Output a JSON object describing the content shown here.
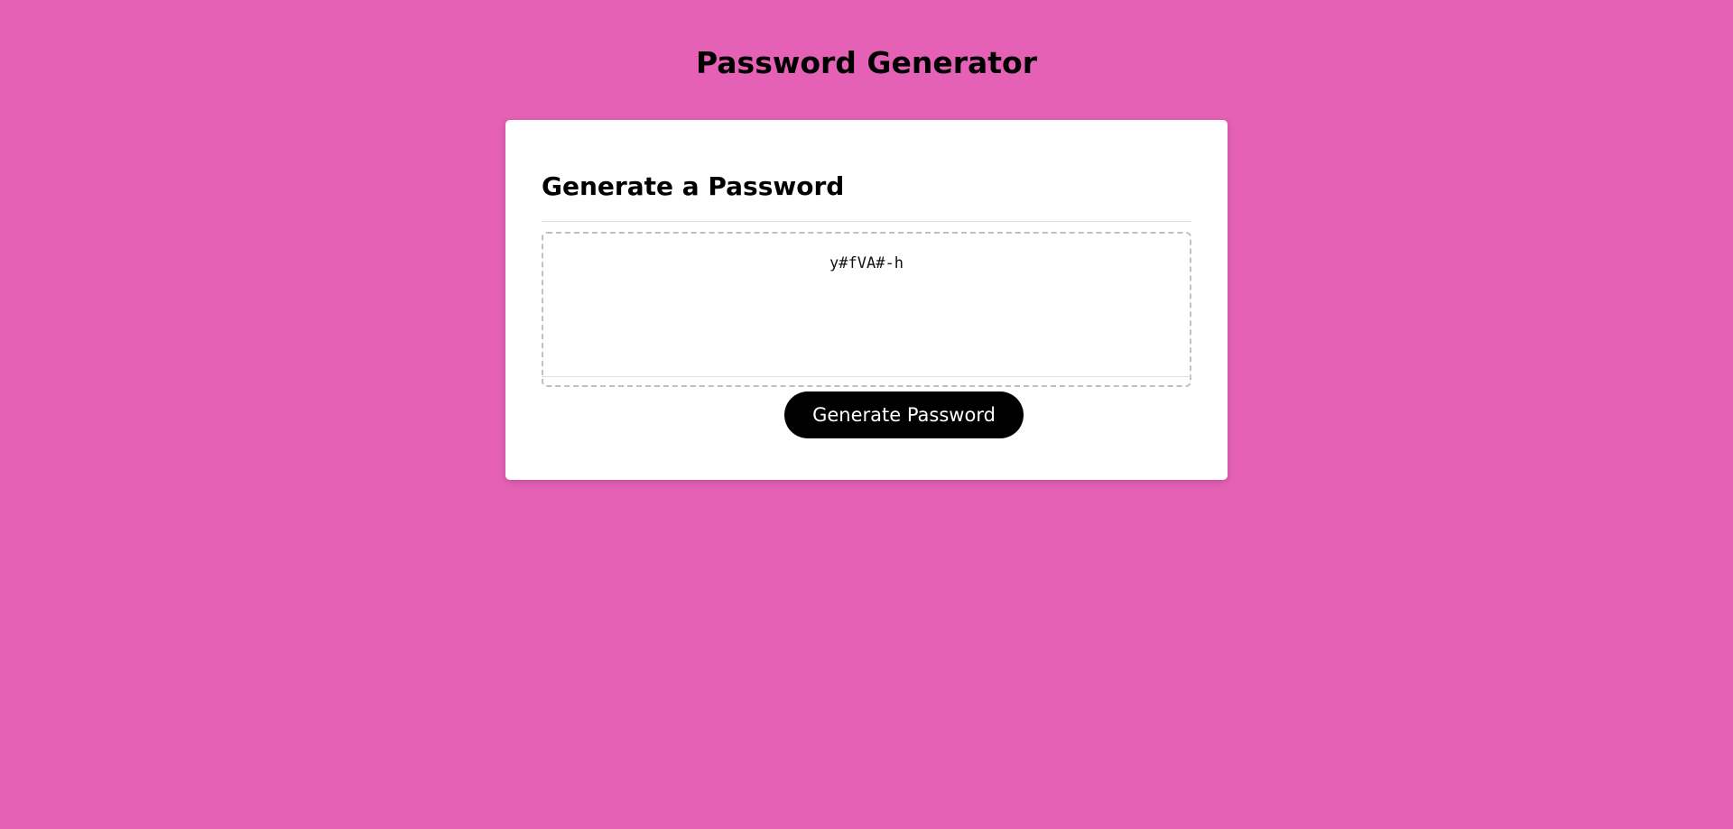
{
  "header": {
    "title": "Password Generator"
  },
  "card": {
    "heading": "Generate a Password",
    "password_value": "y#fVA#-h",
    "generate_button_label": "Generate Password"
  },
  "colors": {
    "background": "#e561b5",
    "card": "#ffffff",
    "button": "#000000",
    "button_text": "#ffffff"
  }
}
